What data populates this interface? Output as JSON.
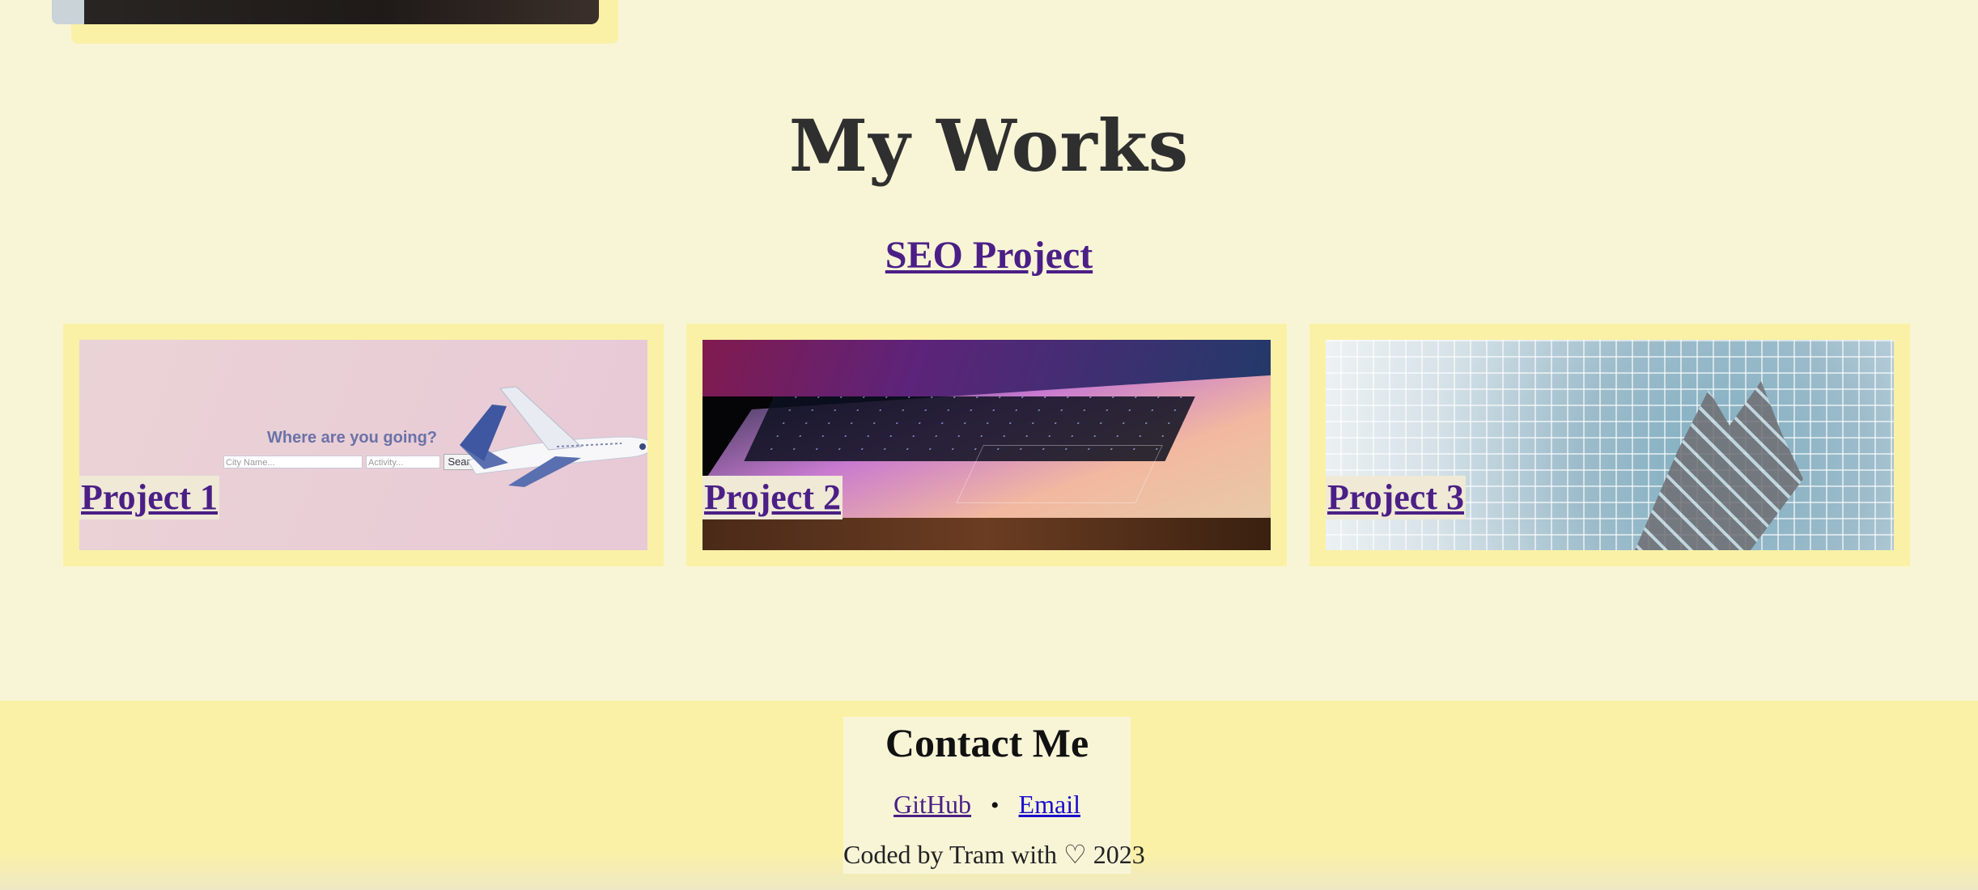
{
  "page": {
    "background": "#f8f5d7",
    "card_color": "#faf1a6",
    "link_color": "#4b1f86"
  },
  "works": {
    "title": "My Works",
    "featured_link": "SEO Project",
    "projects": [
      {
        "label": "Project 1",
        "thumb": {
          "heading": "Where are you going?",
          "city_placeholder": "City Name...",
          "activity_placeholder": "Activity...",
          "search_button": "Search"
        }
      },
      {
        "label": "Project 2"
      },
      {
        "label": "Project 3"
      }
    ]
  },
  "footer": {
    "title": "Contact Me",
    "links": {
      "github": "GitHub",
      "separator": "•",
      "email": "Email"
    },
    "credit": "Coded by Tram with ♡ 2023"
  }
}
